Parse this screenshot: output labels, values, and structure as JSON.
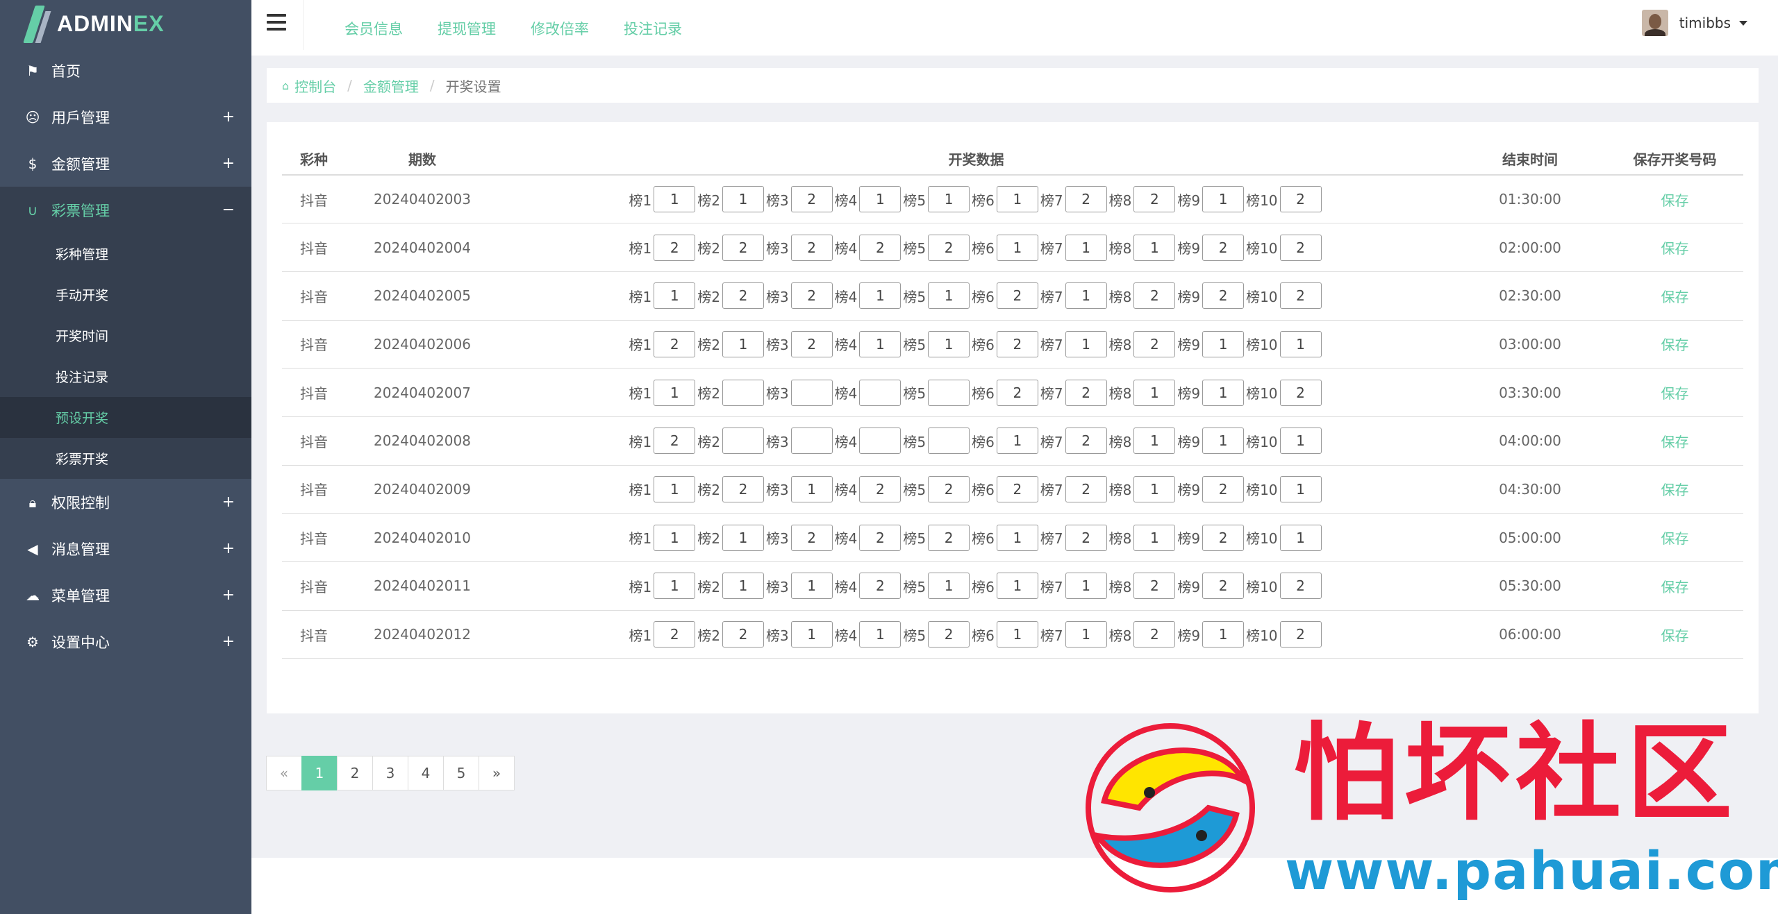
{
  "logo": {
    "main": "ADMIN",
    "accent": "EX"
  },
  "sidebar": {
    "items": [
      {
        "label": "首页",
        "icon": "flag-icon"
      },
      {
        "label": "用戶管理",
        "icon": "smile-icon"
      },
      {
        "label": "金额管理",
        "icon": "dollar-icon"
      },
      {
        "label": "彩票管理",
        "icon": "magnet-icon"
      },
      {
        "label": "权限控制",
        "icon": "lock-icon"
      },
      {
        "label": "消息管理",
        "icon": "bullhorn-icon"
      },
      {
        "label": "菜单管理",
        "icon": "cloud-icon"
      },
      {
        "label": "设置中心",
        "icon": "gear-icon"
      }
    ],
    "lottery_sub": [
      "彩种管理",
      "手动开奖",
      "开奖时间",
      "投注记录",
      "预设开奖",
      "彩票开奖"
    ],
    "current_sub": "预设开奖"
  },
  "header": {
    "nav": [
      "会员信息",
      "提现管理",
      "修改倍率",
      "投注记录"
    ],
    "user": "timibbs"
  },
  "breadcrumb": {
    "home": "控制台",
    "parent": "金额管理",
    "current": "开奖设置"
  },
  "table": {
    "headers": {
      "type": "彩种",
      "period": "期数",
      "data": "开奖数据",
      "end": "结束时间",
      "save": "保存开奖号码"
    },
    "slot_labels": [
      "榜1",
      "榜2",
      "榜3",
      "榜4",
      "榜5",
      "榜6",
      "榜7",
      "榜8",
      "榜9",
      "榜10"
    ],
    "save_label": "保存",
    "rows": [
      {
        "type": "抖音",
        "period": "20240402003",
        "values": [
          "1",
          "1",
          "2",
          "1",
          "1",
          "1",
          "2",
          "2",
          "1",
          "2"
        ],
        "end": "01:30:00"
      },
      {
        "type": "抖音",
        "period": "20240402004",
        "values": [
          "2",
          "2",
          "2",
          "2",
          "2",
          "1",
          "1",
          "1",
          "2",
          "2"
        ],
        "end": "02:00:00"
      },
      {
        "type": "抖音",
        "period": "20240402005",
        "values": [
          "1",
          "2",
          "2",
          "1",
          "1",
          "2",
          "1",
          "2",
          "2",
          "2"
        ],
        "end": "02:30:00"
      },
      {
        "type": "抖音",
        "period": "20240402006",
        "values": [
          "2",
          "1",
          "2",
          "1",
          "1",
          "2",
          "1",
          "2",
          "1",
          "1"
        ],
        "end": "03:00:00"
      },
      {
        "type": "抖音",
        "period": "20240402007",
        "values": [
          "1",
          "",
          "",
          "",
          "",
          "2",
          "2",
          "1",
          "1",
          "2"
        ],
        "end": "03:30:00"
      },
      {
        "type": "抖音",
        "period": "20240402008",
        "values": [
          "2",
          "",
          "",
          "",
          "",
          "1",
          "2",
          "1",
          "1",
          "1"
        ],
        "end": "04:00:00"
      },
      {
        "type": "抖音",
        "period": "20240402009",
        "values": [
          "1",
          "2",
          "1",
          "2",
          "2",
          "2",
          "2",
          "1",
          "2",
          "1"
        ],
        "end": "04:30:00"
      },
      {
        "type": "抖音",
        "period": "20240402010",
        "values": [
          "1",
          "1",
          "2",
          "2",
          "2",
          "1",
          "2",
          "1",
          "2",
          "1"
        ],
        "end": "05:00:00"
      },
      {
        "type": "抖音",
        "period": "20240402011",
        "values": [
          "1",
          "1",
          "1",
          "2",
          "1",
          "1",
          "1",
          "2",
          "2",
          "2"
        ],
        "end": "05:30:00"
      },
      {
        "type": "抖音",
        "period": "20240402012",
        "values": [
          "2",
          "2",
          "1",
          "1",
          "2",
          "1",
          "1",
          "2",
          "1",
          "2"
        ],
        "end": "06:00:00"
      }
    ]
  },
  "pagination": {
    "prev": "«",
    "pages": [
      "1",
      "2",
      "3",
      "4",
      "5"
    ],
    "next": "»",
    "current": "1"
  },
  "watermark": {
    "text": "怕坏社区",
    "url": "www.pahuai.com"
  },
  "colors": {
    "accent": "#65cea7",
    "sidebar": "#424f63",
    "sidebar_active": "#353f4f"
  }
}
